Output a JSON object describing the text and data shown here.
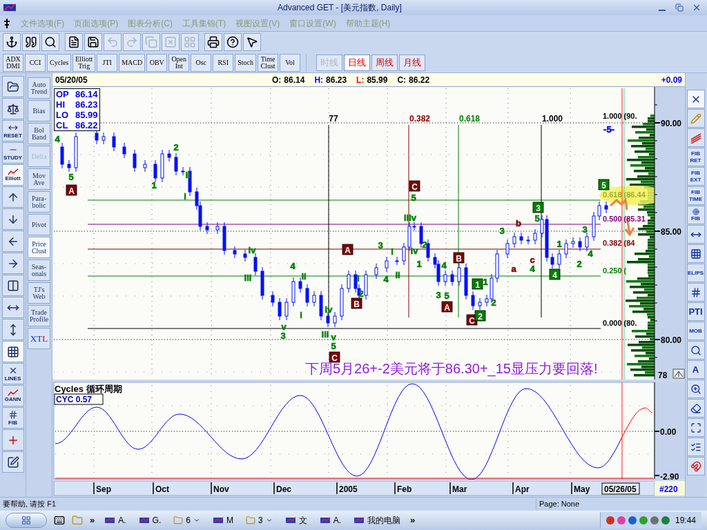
{
  "window": {
    "title": "Advanced GET - [美元指数, Daily]"
  },
  "menu": [
    {
      "label": "文件选项(F)"
    },
    {
      "label": "页面选项(P)"
    },
    {
      "label": "图表分析(C)"
    },
    {
      "label": "工具集锦(T)"
    },
    {
      "label": "视图设置(V)"
    },
    {
      "label": "窗口设置(W)"
    },
    {
      "label": "帮助主题(H)"
    }
  ],
  "toolbar": [
    {
      "disabled": false
    },
    {
      "disabled": false
    },
    {
      "disabled": false
    },
    {
      "disabled": false
    },
    {
      "disabled": false
    },
    {
      "disabled": true
    },
    {
      "disabled": true
    },
    {
      "disabled": true
    },
    {
      "disabled": true
    },
    {
      "disabled": true
    },
    {
      "disabled": false
    },
    {
      "disabled": false
    },
    {
      "disabled": false
    }
  ],
  "indicators": [
    {
      "lines": [
        "ADX",
        "DMI"
      ]
    },
    {
      "lines": [
        "CCI"
      ]
    },
    {
      "lines": [
        "Cycles"
      ]
    },
    {
      "lines": [
        "Elliott",
        "Trig"
      ]
    },
    {
      "lines": [
        "JTI"
      ]
    },
    {
      "lines": [
        "MACD"
      ]
    },
    {
      "lines": [
        "OBV"
      ]
    },
    {
      "lines": [
        "Open",
        "Int"
      ]
    },
    {
      "lines": [
        "Osc"
      ]
    },
    {
      "lines": [
        "RSI"
      ]
    },
    {
      "lines": [
        "Stoch"
      ]
    },
    {
      "lines": [
        "Time",
        "Clust"
      ]
    },
    {
      "lines": [
        "Vol"
      ]
    }
  ],
  "timeframes": [
    {
      "label": "时线",
      "disabled": true,
      "selected": false
    },
    {
      "label": "日线",
      "disabled": false,
      "selected": true
    },
    {
      "label": "周线",
      "disabled": false,
      "selected": false
    },
    {
      "label": "月线",
      "disabled": false,
      "selected": false
    }
  ],
  "left_tools": [
    {
      "selected": false
    },
    {
      "selected": false
    },
    {
      "label": "RESET",
      "selected": false
    },
    {
      "label": "STUDY",
      "selected": false
    },
    {
      "label": "Elliott",
      "selected": true
    },
    {
      "selected": false
    },
    {
      "selected": false
    },
    {
      "selected": false
    },
    {
      "selected": false
    },
    {
      "selected": false
    },
    {
      "selected": false
    },
    {
      "selected": false
    },
    {
      "selected": true
    },
    {
      "label": "LINES",
      "selected": false
    },
    {
      "label": "GANN",
      "selected": false
    },
    {
      "label": "FIB",
      "selected": false
    },
    {
      "selected": false
    },
    {
      "selected": false
    }
  ],
  "studies": [
    {
      "lines": [
        "Auto",
        "Trend"
      ],
      "disabled": false,
      "selected": false
    },
    {
      "lines": [
        "Bias"
      ],
      "disabled": false,
      "selected": false
    },
    {
      "lines": [
        "Bol",
        "Band"
      ],
      "disabled": false,
      "selected": false
    },
    {
      "lines": [
        "Delta"
      ],
      "disabled": true,
      "selected": false
    },
    {
      "lines": [
        "Mov",
        "Ave"
      ],
      "disabled": false,
      "selected": false
    },
    {
      "lines": [
        "Para-",
        "bolic"
      ],
      "disabled": false,
      "selected": false
    },
    {
      "lines": [
        "Pivot"
      ],
      "disabled": false,
      "selected": false
    },
    {
      "lines": [
        "Price",
        "Clust"
      ],
      "disabled": false,
      "selected": true
    },
    {
      "lines": [
        "Seas-",
        "onals"
      ],
      "disabled": false,
      "selected": false
    },
    {
      "lines": [
        "TJ's",
        "Web"
      ],
      "disabled": false,
      "selected": false
    },
    {
      "lines": [
        "Trade",
        "Profile"
      ],
      "disabled": false,
      "selected": false
    },
    {
      "parts": [
        "XT",
        "L"
      ],
      "disabled": false,
      "selected": false
    }
  ],
  "chart": {
    "date": "05/20/05",
    "ohlc": [
      {
        "label": "O:",
        "value": "86.14",
        "color": "#000000"
      },
      {
        "label": "H:",
        "value": "86.23",
        "color": "#0000ff"
      },
      {
        "label": "L:",
        "value": "85.99",
        "color": "#ff0000"
      },
      {
        "label": "C:",
        "value": "86.22",
        "color": "#000000"
      }
    ],
    "change": "+0.09",
    "info_box": [
      {
        "label": "OP",
        "value": "86.14"
      },
      {
        "label": "HI",
        "value": "86.23"
      },
      {
        "label": "LO",
        "value": "85.99"
      },
      {
        "label": "CL",
        "value": "86.22"
      }
    ],
    "time_fib": [
      {
        "label": "77",
        "color": "#000000"
      },
      {
        "label": "0.382",
        "color": "#8b0000"
      },
      {
        "label": "0.618",
        "color": "#008000"
      },
      {
        "label": "1.000",
        "color": "#000000"
      }
    ],
    "retracements": [
      {
        "label": "1.000 (90.",
        "color": "#000000"
      },
      {
        "label": "0.618 (86.44",
        "color": "#a8a830"
      },
      {
        "label": "0.500 (85.31",
        "color": "#800080"
      },
      {
        "label": "0.382 (84",
        "color": "#800000"
      },
      {
        "label": "0.250 (",
        "color": "#008000"
      },
      {
        "label": "0.000 (80.",
        "color": "#000000"
      }
    ],
    "wave_labels": [
      {
        "text": "4",
        "kind": "plain",
        "color": "#008000"
      },
      {
        "text": "5",
        "kind": "plain",
        "color": "#008000"
      },
      {
        "text": "A",
        "kind": "box",
        "color": "#800000"
      },
      {
        "text": "2",
        "kind": "plain",
        "color": "#008000"
      },
      {
        "text": "1",
        "kind": "plain",
        "color": "#008000"
      },
      {
        "text": "ii",
        "kind": "plain",
        "color": "#008000"
      },
      {
        "text": "i",
        "kind": "plain",
        "color": "#008000"
      },
      {
        "text": "iv",
        "kind": "plain",
        "color": "#008000"
      },
      {
        "text": "iii",
        "kind": "plain",
        "color": "#008000"
      },
      {
        "text": "v",
        "kind": "plain",
        "color": "#008000"
      },
      {
        "text": "3",
        "kind": "plain",
        "color": "#008000"
      },
      {
        "text": "4",
        "kind": "plain",
        "color": "#008000"
      },
      {
        "text": "ii",
        "kind": "plain",
        "color": "#008000"
      },
      {
        "text": "i",
        "kind": "plain",
        "color": "#008000"
      },
      {
        "text": "iv",
        "kind": "plain",
        "color": "#008000"
      },
      {
        "text": "iii",
        "kind": "plain",
        "color": "#008000"
      },
      {
        "text": "v",
        "kind": "plain",
        "color": "#008000"
      },
      {
        "text": "5",
        "kind": "plain",
        "color": "#008000"
      },
      {
        "text": "C",
        "kind": "box",
        "color": "#800000"
      },
      {
        "text": "A",
        "kind": "box",
        "color": "#800000"
      },
      {
        "text": "3",
        "kind": "plain",
        "color": "#008000"
      },
      {
        "text": "i",
        "kind": "plain",
        "color": "#008000"
      },
      {
        "text": "i",
        "kind": "plain",
        "color": "#008000"
      },
      {
        "text": "2",
        "kind": "plain",
        "color": "#008000"
      },
      {
        "text": "B",
        "kind": "box",
        "color": "#800000"
      },
      {
        "text": "4",
        "kind": "plain",
        "color": "#008000"
      },
      {
        "text": "ii",
        "kind": "plain",
        "color": "#008000"
      },
      {
        "text": "C",
        "kind": "box",
        "color": "#800000"
      },
      {
        "text": "5",
        "kind": "plain",
        "color": "#008000"
      },
      {
        "text": "iiiv",
        "kind": "plain",
        "color": "#008000"
      },
      {
        "text": "iv",
        "kind": "plain",
        "color": "#008000"
      },
      {
        "text": "2",
        "kind": "plain",
        "color": "#008000"
      },
      {
        "text": "1",
        "kind": "plain",
        "color": "#008000"
      },
      {
        "text": "4",
        "kind": "plain",
        "color": "#008000"
      },
      {
        "text": "3",
        "kind": "plain",
        "color": "#008000"
      },
      {
        "text": "5",
        "kind": "plain",
        "color": "#008000"
      },
      {
        "text": "A",
        "kind": "box",
        "color": "#800000"
      },
      {
        "text": "B",
        "kind": "box",
        "color": "#800000"
      },
      {
        "text": "1",
        "kind": "box",
        "color": "#008000"
      },
      {
        "text": "1",
        "kind": "plain",
        "color": "#008000"
      },
      {
        "text": "2",
        "kind": "plain",
        "color": "#008000"
      },
      {
        "text": "C",
        "kind": "box",
        "color": "#800000"
      },
      {
        "text": "2",
        "kind": "box",
        "color": "#008000"
      },
      {
        "text": "3",
        "kind": "plain",
        "color": "#008000"
      },
      {
        "text": "b",
        "kind": "plain",
        "color": "#800000"
      },
      {
        "text": "a",
        "kind": "plain",
        "color": "#800000"
      },
      {
        "text": "c",
        "kind": "plain",
        "color": "#800000"
      },
      {
        "text": "4",
        "kind": "plain",
        "color": "#008000"
      },
      {
        "text": "3",
        "kind": "box",
        "color": "#008000"
      },
      {
        "text": "5",
        "kind": "plain",
        "color": "#008000"
      },
      {
        "text": "1",
        "kind": "plain",
        "color": "#008000"
      },
      {
        "text": "2",
        "kind": "plain",
        "color": "#008000"
      },
      {
        "text": "3",
        "kind": "plain",
        "color": "#008000"
      },
      {
        "text": "4",
        "kind": "plain",
        "color": "#008000"
      },
      {
        "text": "4",
        "kind": "box",
        "color": "#008000"
      },
      {
        "text": "5",
        "kind": "box",
        "color": "#008000"
      },
      {
        "text": "-5-",
        "kind": "plain",
        "color": "#0000ff"
      }
    ],
    "annotation": "下周5月26+-2美元将于86.30+_15显压力要回落!",
    "price_axis": [
      "90.00",
      "85.00",
      "80.00"
    ],
    "axis_corner": "78"
  },
  "cycles": {
    "title": "Cycles 循环周期",
    "reading": "CYC 0.57",
    "axis": [
      "0.00",
      "-2.90"
    ]
  },
  "date_axis": {
    "months": [
      "Sep",
      "Oct",
      "Nov",
      "Dec",
      "2005",
      "Feb",
      "Mar",
      "Apr",
      "May"
    ],
    "cursor_date": "05/26/05",
    "bar_count": "#220"
  },
  "right_tools": [
    {
      "selected": true
    },
    {
      "selected": false
    },
    {
      "selected": false
    },
    {
      "lines": [
        "FIB",
        "RET"
      ],
      "selected": false
    },
    {
      "lines": [
        "FIB",
        "EXT"
      ],
      "selected": false
    },
    {
      "lines": [
        "FIB",
        "TIME"
      ],
      "selected": false
    },
    {
      "lines": [
        "FIB"
      ],
      "selected": false
    },
    {
      "selected": false
    },
    {
      "selected": false
    },
    {
      "lines": [
        "ELIPS"
      ],
      "selected": false
    },
    {
      "selected": false
    },
    {
      "lines": [
        "PTI"
      ],
      "selected": false
    },
    {
      "lines": [
        "MOB"
      ],
      "selected": false
    },
    {
      "selected": false
    },
    {
      "lines": [
        "A"
      ],
      "selected": false
    },
    {
      "selected": false
    },
    {
      "selected": false
    },
    {
      "selected": false
    },
    {
      "selected": false
    },
    {
      "selected": false
    }
  ],
  "status_bar": {
    "help": "要帮助, 请按 F1",
    "page": "Page: None"
  },
  "taskbar": {
    "items": [
      {
        "kind": "chevron",
        "label": "»"
      },
      {
        "kind": "task",
        "label": "A."
      },
      {
        "kind": "task",
        "label": "G."
      },
      {
        "kind": "group",
        "label": "6"
      },
      {
        "kind": "task",
        "label": "M"
      },
      {
        "kind": "group",
        "label": "3"
      },
      {
        "kind": "task",
        "label": "文"
      },
      {
        "kind": "task",
        "label": "A."
      },
      {
        "kind": "task",
        "label": "我的电脑"
      },
      {
        "kind": "chevron",
        "label": "»"
      }
    ],
    "clock": "19:44"
  }
}
